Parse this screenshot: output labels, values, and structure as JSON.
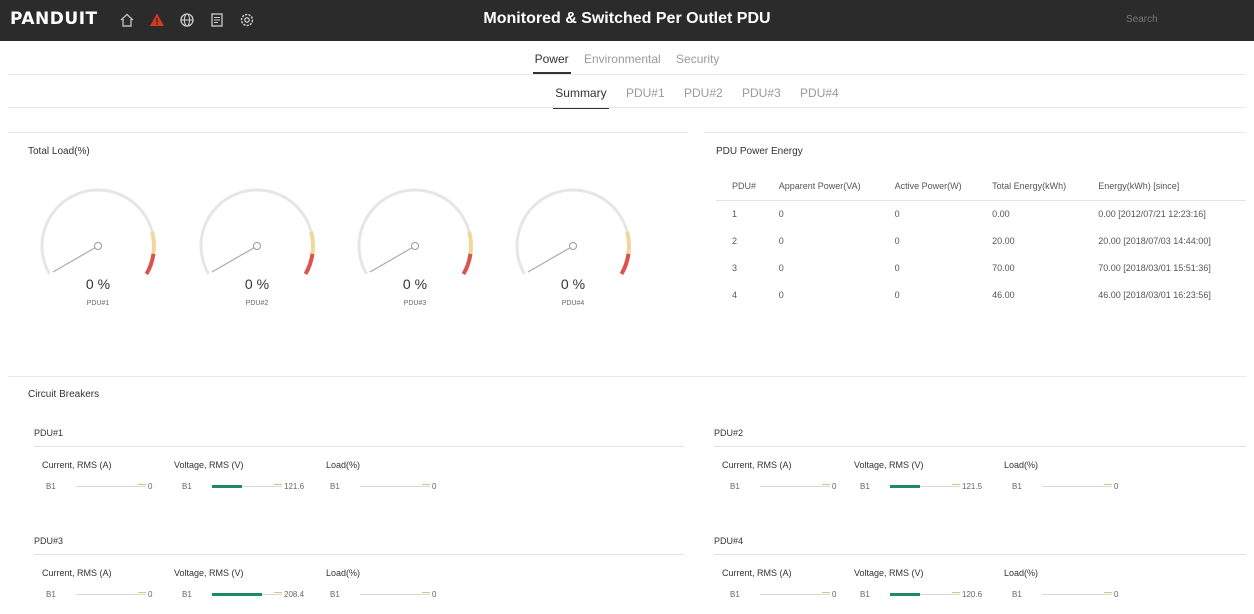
{
  "app": {
    "logo": "PANDUIT",
    "title": "Monitored & Switched Per Outlet PDU",
    "search_placeholder": "Search"
  },
  "nav_icons": [
    {
      "name": "home-icon",
      "color": "#bbbbbb"
    },
    {
      "name": "alert-icon",
      "color": "#d9381e"
    },
    {
      "name": "globe-icon",
      "color": "#cccccc"
    },
    {
      "name": "document-icon",
      "color": "#cccccc"
    },
    {
      "name": "settings-icon",
      "color": "#cccccc"
    }
  ],
  "main_tabs": [
    "Power",
    "Environmental",
    "Security"
  ],
  "sub_tabs": [
    "Summary",
    "PDU#1",
    "PDU#2",
    "PDU#3",
    "PDU#4"
  ],
  "total_load": {
    "title": "Total Load(%)",
    "gauges": [
      {
        "value": "0",
        "unit": "%",
        "label": "PDU#1",
        "level": 0
      },
      {
        "value": "0",
        "unit": "%",
        "label": "PDU#2",
        "level": 0
      },
      {
        "value": "0",
        "unit": "%",
        "label": "PDU#3",
        "level": 0
      },
      {
        "value": "0",
        "unit": "%",
        "label": "PDU#4",
        "level": 0
      }
    ]
  },
  "energy": {
    "title": "PDU Power Energy",
    "headers": [
      "PDU#",
      "Apparent Power(VA)",
      "Active Power(W)",
      "Total Energy(kWh)",
      "Energy(kWh) [since]"
    ],
    "rows": [
      [
        "1",
        "0",
        "0",
        "0.00",
        "0.00 [2012/07/21 12:23:16]"
      ],
      [
        "2",
        "0",
        "0",
        "20.00",
        "20.00 [2018/07/03 14:44:00]"
      ],
      [
        "3",
        "0",
        "0",
        "70.00",
        "70.00 [2018/03/01 15:51:36]"
      ],
      [
        "4",
        "0",
        "0",
        "46.00",
        "46.00 [2018/03/01 16:23:56]"
      ]
    ]
  },
  "breakers": {
    "title": "Circuit Breakers",
    "column_headers": [
      "Current, RMS (A)",
      "Voltage, RMS (V)",
      "Load(%)"
    ],
    "pdus": [
      {
        "name": "PDU#1",
        "label": "B1",
        "current": "0",
        "voltage": "121.6",
        "load": "0",
        "voltage_level": 0.55
      },
      {
        "name": "PDU#2",
        "label": "B1",
        "current": "0",
        "voltage": "121.5",
        "load": "0",
        "voltage_level": 0.55
      },
      {
        "name": "PDU#3",
        "label": "B1",
        "current": "0",
        "voltage": "208.4",
        "load": "0",
        "voltage_level": 0.9
      },
      {
        "name": "PDU#4",
        "label": "B1",
        "current": "0",
        "voltage": "120.6",
        "load": "0",
        "voltage_level": 0.55
      }
    ]
  },
  "colors": {
    "topbar": "#2b2b2b",
    "gauge_arc": "#e6e6e6",
    "gauge_warn": "#f1d79a",
    "gauge_danger": "#d9534f",
    "meter_fill": "#1f8a6a"
  }
}
